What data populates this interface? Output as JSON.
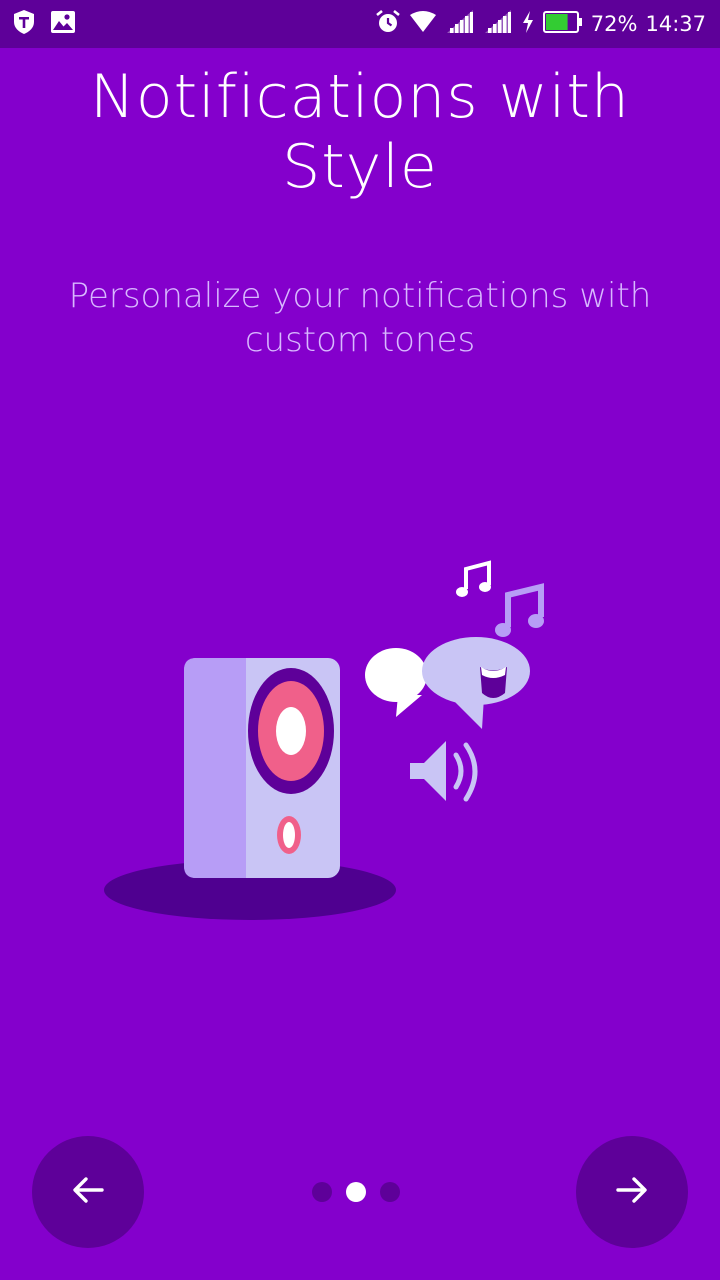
{
  "status_bar": {
    "battery_percent_label": "72%",
    "battery_level": 0.72,
    "time": "14:37",
    "icons": [
      "shield-app-icon",
      "gallery-icon",
      "alarm-icon",
      "wifi-icon",
      "signal-icon",
      "signal-icon",
      "charging-icon",
      "battery-icon"
    ]
  },
  "onboarding": {
    "title": "Notifications with Style",
    "subtitle": "Personalize your notifications with custom tones"
  },
  "pager": {
    "page_count": 3,
    "current_page": 2
  },
  "colors": {
    "background": "#8400CC",
    "status_bar": "#5E0099",
    "subtitle": "#D8B8FF",
    "button": "#5E0099",
    "speaker_pink": "#F0608A",
    "speaker_light": "#C9C5F5"
  }
}
